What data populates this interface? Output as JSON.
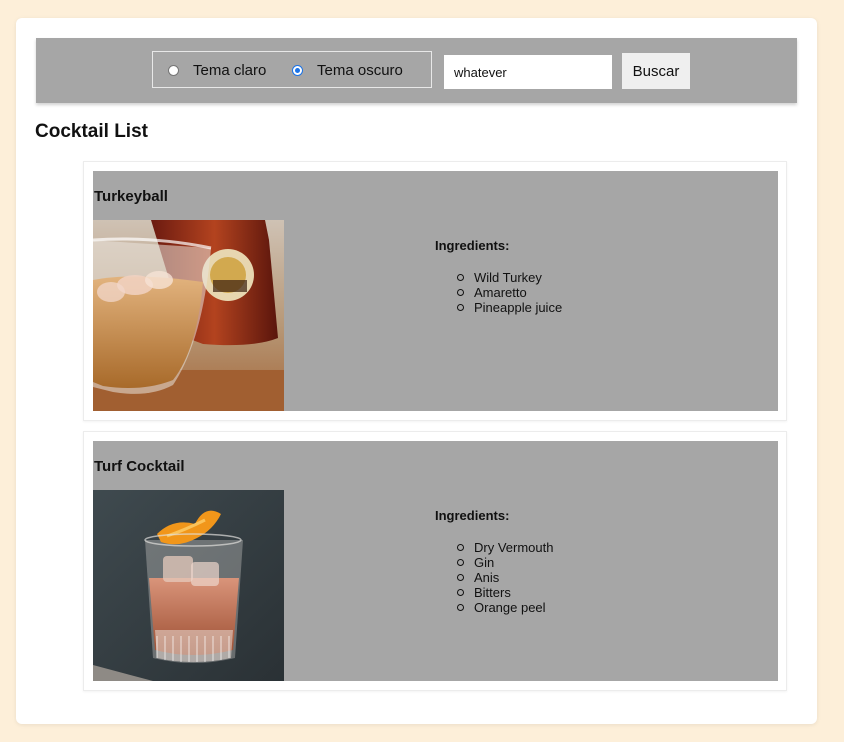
{
  "header": {
    "theme_options": [
      {
        "label": "Tema claro",
        "checked": false
      },
      {
        "label": "Tema oscuro",
        "checked": true
      }
    ],
    "search": {
      "value": "whatever"
    },
    "search_button_label": "Buscar"
  },
  "main": {
    "title": "Cocktail List",
    "ingredients_label": "Ingredients:",
    "cocktails": [
      {
        "name": "Turkeyball",
        "ingredients": [
          "Wild Turkey",
          "Amaretto",
          "Pineapple juice"
        ]
      },
      {
        "name": "Turf Cocktail",
        "ingredients": [
          "Dry Vermouth",
          "Gin",
          "Anis",
          "Bitters",
          "Orange peel"
        ]
      }
    ]
  },
  "colors": {
    "page_background": "#fdefd9",
    "toolbar_background": "#a6a6a6",
    "card_inner_background": "#a6a6a6",
    "radio_accent": "#1a73e8"
  }
}
